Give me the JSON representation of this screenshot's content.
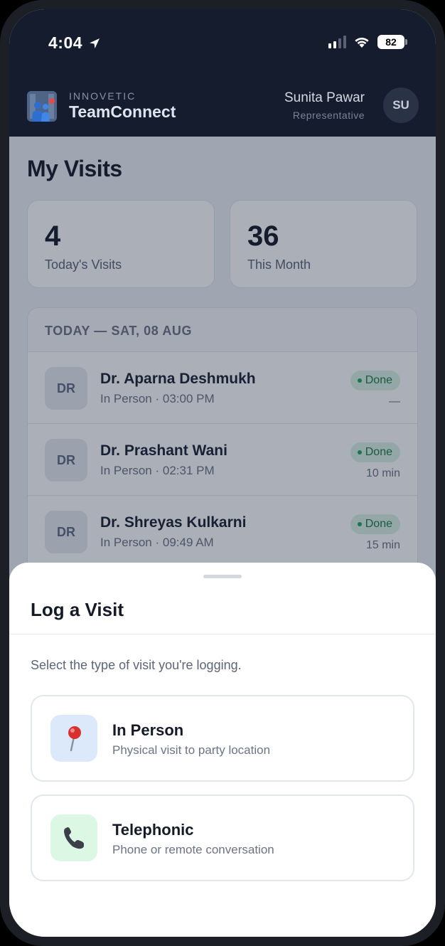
{
  "status_bar": {
    "time": "4:04",
    "battery": "82"
  },
  "header": {
    "brand_sub": "INNOVETIC",
    "brand_main": "TeamConnect",
    "user_name": "Sunita Pawar",
    "user_role": "Representative",
    "user_initials": "SU"
  },
  "page": {
    "title": "My Visits"
  },
  "stats": [
    {
      "value": "4",
      "label": "Today's Visits"
    },
    {
      "value": "36",
      "label": "This Month"
    }
  ],
  "visits": {
    "header": "TODAY — SAT, 08 AUG",
    "items": [
      {
        "initials": "DR",
        "name": "Dr. Aparna Deshmukh",
        "meta": "In Person · 03:00 PM",
        "status": "Done",
        "duration": "—"
      },
      {
        "initials": "DR",
        "name": "Dr. Prashant Wani",
        "meta": "In Person · 02:31 PM",
        "status": "Done",
        "duration": "10 min"
      },
      {
        "initials": "DR",
        "name": "Dr. Shreyas Kulkarni",
        "meta": "In Person · 09:49 AM",
        "status": "Done",
        "duration": "15 min"
      }
    ]
  },
  "sheet": {
    "title": "Log a Visit",
    "description": "Select the type of visit you're logging.",
    "options": [
      {
        "title": "In Person",
        "description": "Physical visit to party location",
        "icon": "pushpin-icon",
        "icon_bg": "#dce9fb"
      },
      {
        "title": "Telephonic",
        "description": "Phone or remote conversation",
        "icon": "phone-icon",
        "icon_bg": "#dcf7e3"
      }
    ]
  },
  "colors": {
    "header_bg": "#141c2e",
    "done_badge_bg": "#dbf2e4",
    "done_text": "#1d7a43"
  }
}
